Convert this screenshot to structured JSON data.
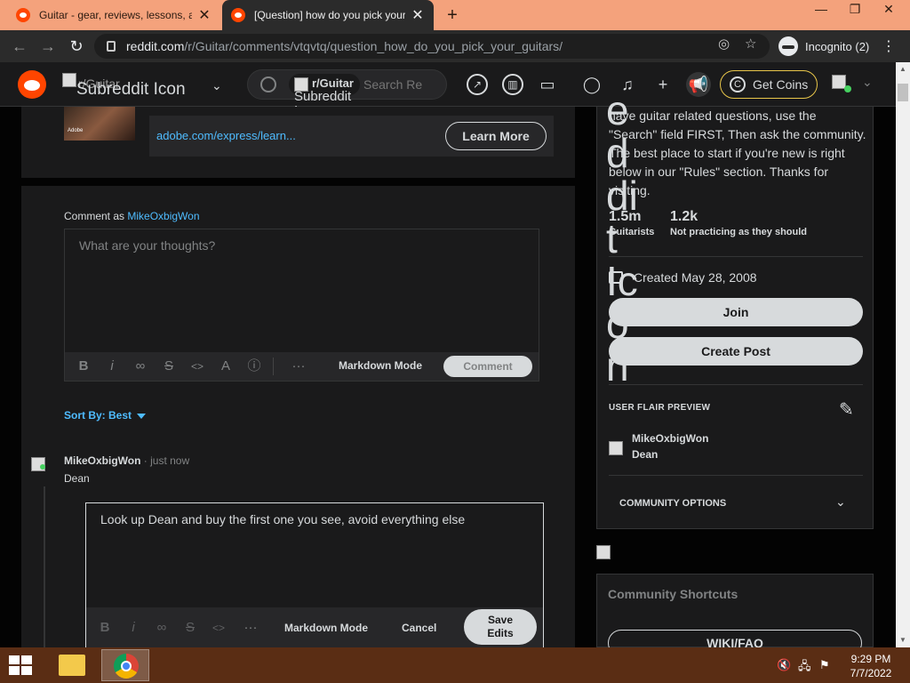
{
  "browser": {
    "tabs": [
      {
        "title": "Guitar - gear, reviews, lessons, an",
        "active": false
      },
      {
        "title": "[Question] how do you pick your",
        "active": true
      }
    ],
    "url_domain": "reddit.com",
    "url_path": "/r/Guitar/comments/vtqvtq/question_how_do_you_pick_your_guitars/",
    "incognito_label": "Incognito (2)",
    "window_controls": {
      "minimize": "—",
      "restore": "❐",
      "close": "✕"
    }
  },
  "header": {
    "community_alt": "Subreddit Icon",
    "community_label": "r/Guitar",
    "search_pill_label": "r/Guitar",
    "search_pill_alt": "Subreddit Icon",
    "search_placeholder": "Search Re",
    "get_coins_label": "Get Coins"
  },
  "ad": {
    "thumb_caption": "Adobe",
    "link_text": "adobe.com/express/learn...",
    "cta_label": "Learn More"
  },
  "comment_form": {
    "comment_as_prefix": "Comment as",
    "username": "MikeOxbigWon",
    "placeholder": "What are your thoughts?",
    "markdown_mode_label": "Markdown Mode",
    "submit_label": "Comment"
  },
  "sort": {
    "label": "Sort By: Best"
  },
  "comment": {
    "author": "MikeOxbigWon",
    "timestamp": "· just now",
    "flair": "Dean",
    "edit_text": "Look up Dean and buy the first one you see, avoid everything else",
    "markdown_mode_label": "Markdown Mode",
    "cancel_label": "Cancel",
    "save_label_line1": "Save",
    "save_label_line2": "Edits"
  },
  "sidebar": {
    "description": "have guitar related questions, use the \"Search\" field FIRST, Then ask the community. The best place to start if you're new is right below in our \"Rules\" section. Thanks for visiting.",
    "overlay_letters": "e d di t Ic o n",
    "members_count": "1.5m",
    "members_label": "Guitarists",
    "online_count": "1.2k",
    "online_label": "Not practicing as they should",
    "created": "Created May 28, 2008",
    "join_label": "Join",
    "create_post_label": "Create Post",
    "user_flair_preview_label": "USER FLAIR PREVIEW",
    "flair_username": "MikeOxbigWon",
    "flair_value": "Dean",
    "community_options_label": "COMMUNITY OPTIONS",
    "shortcuts_title": "Community Shortcuts",
    "wiki_label": "WIKI/FAQ"
  },
  "taskbar": {
    "time": "9:29 PM",
    "date": "7/7/2022"
  }
}
